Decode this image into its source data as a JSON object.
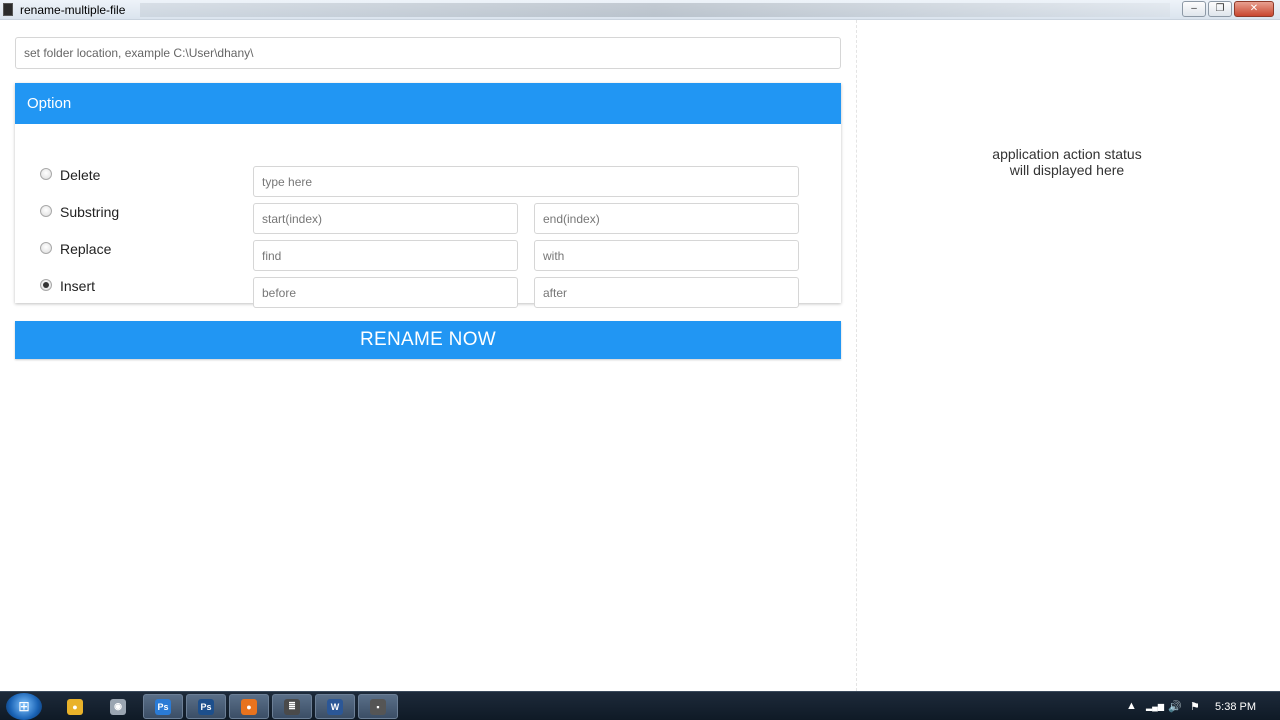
{
  "window": {
    "title": "rename-multiple-file",
    "minimize": "–",
    "maximize": "❐",
    "close": "✕"
  },
  "folder": {
    "placeholder": "set folder location, example C:\\User\\dhany\\"
  },
  "option": {
    "header": "Option",
    "rows": [
      {
        "label": "Delete",
        "checked": false,
        "fields": [
          "type here"
        ]
      },
      {
        "label": "Substring",
        "checked": false,
        "fields": [
          "start(index)",
          "end(index)"
        ]
      },
      {
        "label": "Replace",
        "checked": false,
        "fields": [
          "find",
          "with"
        ]
      },
      {
        "label": "Insert",
        "checked": true,
        "fields": [
          "before",
          "after"
        ]
      }
    ]
  },
  "rename_button": "RENAME NOW",
  "status": {
    "line1": "application action status",
    "line2": "will displayed here"
  },
  "taskbar": {
    "start_icon": "windows-start-icon",
    "apps": [
      {
        "name": "chrome-icon",
        "glyph": "●",
        "color": "#e9b22a"
      },
      {
        "name": "camera-icon",
        "glyph": "◉",
        "color": "#9aa5b1"
      },
      {
        "name": "photoshop-icon",
        "glyph": "Ps",
        "color": "#2a7bd6"
      },
      {
        "name": "photoshop-icon-2",
        "glyph": "Ps",
        "color": "#1d4f8c"
      },
      {
        "name": "firefox-icon",
        "glyph": "●",
        "color": "#e8731e"
      },
      {
        "name": "sublime-text-icon",
        "glyph": "≣",
        "color": "#4a4a4a"
      },
      {
        "name": "word-icon",
        "glyph": "W",
        "color": "#2b5797"
      },
      {
        "name": "app-window-icon",
        "glyph": "▪",
        "color": "#555555"
      }
    ],
    "tray_icons": [
      "up-arrow-icon",
      "signal-icon",
      "volume-icon",
      "flag-icon"
    ],
    "tray_glyphs": [
      "▲",
      "▂▄▆",
      "🔊",
      "⚑"
    ],
    "clock": "5:38 PM"
  },
  "colors": {
    "accent": "#2196f3"
  }
}
